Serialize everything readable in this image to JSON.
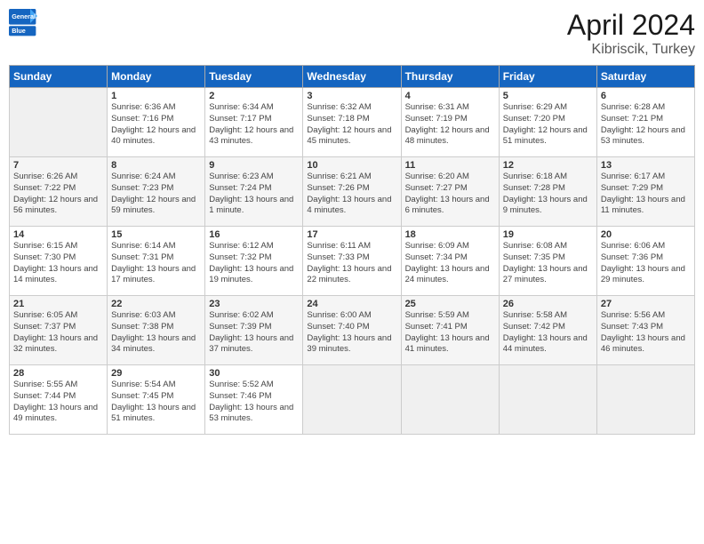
{
  "header": {
    "logo_general": "General",
    "logo_blue": "Blue",
    "main_title": "April 2024",
    "subtitle": "Kibriscik, Turkey"
  },
  "days_of_week": [
    "Sunday",
    "Monday",
    "Tuesday",
    "Wednesday",
    "Thursday",
    "Friday",
    "Saturday"
  ],
  "weeks": [
    [
      {
        "day": "",
        "sunrise": "",
        "sunset": "",
        "daylight": "",
        "empty": true
      },
      {
        "day": "1",
        "sunrise": "6:36 AM",
        "sunset": "7:16 PM",
        "daylight": "12 hours and 40 minutes."
      },
      {
        "day": "2",
        "sunrise": "6:34 AM",
        "sunset": "7:17 PM",
        "daylight": "12 hours and 43 minutes."
      },
      {
        "day": "3",
        "sunrise": "6:32 AM",
        "sunset": "7:18 PM",
        "daylight": "12 hours and 45 minutes."
      },
      {
        "day": "4",
        "sunrise": "6:31 AM",
        "sunset": "7:19 PM",
        "daylight": "12 hours and 48 minutes."
      },
      {
        "day": "5",
        "sunrise": "6:29 AM",
        "sunset": "7:20 PM",
        "daylight": "12 hours and 51 minutes."
      },
      {
        "day": "6",
        "sunrise": "6:28 AM",
        "sunset": "7:21 PM",
        "daylight": "12 hours and 53 minutes."
      }
    ],
    [
      {
        "day": "7",
        "sunrise": "6:26 AM",
        "sunset": "7:22 PM",
        "daylight": "12 hours and 56 minutes."
      },
      {
        "day": "8",
        "sunrise": "6:24 AM",
        "sunset": "7:23 PM",
        "daylight": "12 hours and 59 minutes."
      },
      {
        "day": "9",
        "sunrise": "6:23 AM",
        "sunset": "7:24 PM",
        "daylight": "13 hours and 1 minute."
      },
      {
        "day": "10",
        "sunrise": "6:21 AM",
        "sunset": "7:26 PM",
        "daylight": "13 hours and 4 minutes."
      },
      {
        "day": "11",
        "sunrise": "6:20 AM",
        "sunset": "7:27 PM",
        "daylight": "13 hours and 6 minutes."
      },
      {
        "day": "12",
        "sunrise": "6:18 AM",
        "sunset": "7:28 PM",
        "daylight": "13 hours and 9 minutes."
      },
      {
        "day": "13",
        "sunrise": "6:17 AM",
        "sunset": "7:29 PM",
        "daylight": "13 hours and 11 minutes."
      }
    ],
    [
      {
        "day": "14",
        "sunrise": "6:15 AM",
        "sunset": "7:30 PM",
        "daylight": "13 hours and 14 minutes."
      },
      {
        "day": "15",
        "sunrise": "6:14 AM",
        "sunset": "7:31 PM",
        "daylight": "13 hours and 17 minutes."
      },
      {
        "day": "16",
        "sunrise": "6:12 AM",
        "sunset": "7:32 PM",
        "daylight": "13 hours and 19 minutes."
      },
      {
        "day": "17",
        "sunrise": "6:11 AM",
        "sunset": "7:33 PM",
        "daylight": "13 hours and 22 minutes."
      },
      {
        "day": "18",
        "sunrise": "6:09 AM",
        "sunset": "7:34 PM",
        "daylight": "13 hours and 24 minutes."
      },
      {
        "day": "19",
        "sunrise": "6:08 AM",
        "sunset": "7:35 PM",
        "daylight": "13 hours and 27 minutes."
      },
      {
        "day": "20",
        "sunrise": "6:06 AM",
        "sunset": "7:36 PM",
        "daylight": "13 hours and 29 minutes."
      }
    ],
    [
      {
        "day": "21",
        "sunrise": "6:05 AM",
        "sunset": "7:37 PM",
        "daylight": "13 hours and 32 minutes."
      },
      {
        "day": "22",
        "sunrise": "6:03 AM",
        "sunset": "7:38 PM",
        "daylight": "13 hours and 34 minutes."
      },
      {
        "day": "23",
        "sunrise": "6:02 AM",
        "sunset": "7:39 PM",
        "daylight": "13 hours and 37 minutes."
      },
      {
        "day": "24",
        "sunrise": "6:00 AM",
        "sunset": "7:40 PM",
        "daylight": "13 hours and 39 minutes."
      },
      {
        "day": "25",
        "sunrise": "5:59 AM",
        "sunset": "7:41 PM",
        "daylight": "13 hours and 41 minutes."
      },
      {
        "day": "26",
        "sunrise": "5:58 AM",
        "sunset": "7:42 PM",
        "daylight": "13 hours and 44 minutes."
      },
      {
        "day": "27",
        "sunrise": "5:56 AM",
        "sunset": "7:43 PM",
        "daylight": "13 hours and 46 minutes."
      }
    ],
    [
      {
        "day": "28",
        "sunrise": "5:55 AM",
        "sunset": "7:44 PM",
        "daylight": "13 hours and 49 minutes."
      },
      {
        "day": "29",
        "sunrise": "5:54 AM",
        "sunset": "7:45 PM",
        "daylight": "13 hours and 51 minutes."
      },
      {
        "day": "30",
        "sunrise": "5:52 AM",
        "sunset": "7:46 PM",
        "daylight": "13 hours and 53 minutes."
      },
      {
        "day": "",
        "sunrise": "",
        "sunset": "",
        "daylight": "",
        "empty": true
      },
      {
        "day": "",
        "sunrise": "",
        "sunset": "",
        "daylight": "",
        "empty": true
      },
      {
        "day": "",
        "sunrise": "",
        "sunset": "",
        "daylight": "",
        "empty": true
      },
      {
        "day": "",
        "sunrise": "",
        "sunset": "",
        "daylight": "",
        "empty": true
      }
    ]
  ]
}
